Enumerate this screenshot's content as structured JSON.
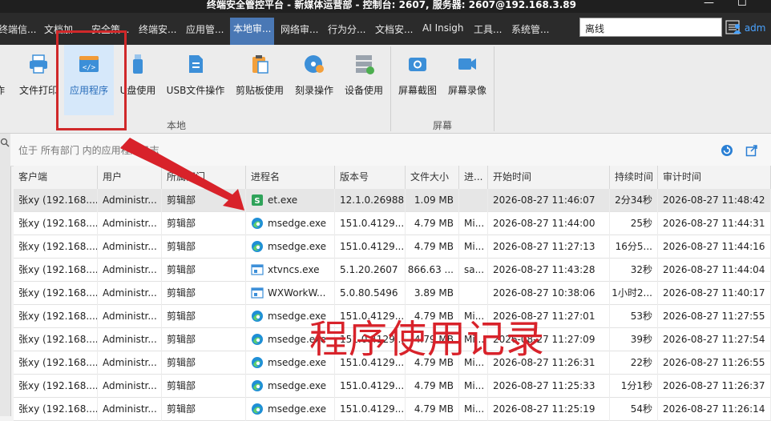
{
  "window": {
    "title": "终端安全管控平台 - 新媒体运营部 - 控制台: 2607, 服务器: 2607@192.168.3.89",
    "minimize": "—",
    "maximize": "☐"
  },
  "menubar": {
    "items": [
      {
        "label": "终端信..."
      },
      {
        "label": "文档加..."
      },
      {
        "label": "安全策..."
      },
      {
        "label": "终端安..."
      },
      {
        "label": "应用管..."
      },
      {
        "label": "本地审..."
      },
      {
        "label": "网络审..."
      },
      {
        "label": "行为分..."
      },
      {
        "label": "文档安..."
      },
      {
        "label": "AI Insigh"
      },
      {
        "label": "工具..."
      },
      {
        "label": "系统管..."
      }
    ],
    "active_index": 5,
    "search_value": "离线",
    "user": "adm"
  },
  "ribbon": {
    "buttons": [
      {
        "label": "作",
        "icon": "print-icon"
      },
      {
        "label": "文件打印",
        "icon": "printer-icon"
      },
      {
        "label": "应用程序",
        "icon": "app-code-icon"
      },
      {
        "label": "U盘使用",
        "icon": "usb-drive-icon"
      },
      {
        "label": "USB文件操作",
        "icon": "usb-file-icon"
      },
      {
        "label": "剪贴板使用",
        "icon": "clipboard-icon"
      },
      {
        "label": "刻录操作",
        "icon": "disc-burn-icon"
      },
      {
        "label": "设备使用",
        "icon": "device-icon"
      },
      {
        "label": "屏幕截图",
        "icon": "screenshot-icon"
      },
      {
        "label": "屏幕录像",
        "icon": "screen-record-icon"
      }
    ],
    "groups": [
      {
        "label": "本地"
      },
      {
        "label": "屏幕"
      }
    ]
  },
  "pathbar": {
    "text": "位于 所有部门 内的应用程序日志"
  },
  "table": {
    "columns": [
      "客户端",
      "用户",
      "所属部门",
      "进程名",
      "版本号",
      "文件大小",
      "进...",
      "开始时间",
      "持续时间",
      "审计时间"
    ],
    "rows": [
      {
        "client": "张xy (192.168....",
        "user": "Administr...",
        "dept": "剪辑部",
        "proc": "et.exe",
        "icon": "wps-icon",
        "ver": "12.1.0.26988",
        "size": "1.09 MB",
        "pub": "",
        "start": "2026-08-27 11:46:07",
        "dur": "2分34秒",
        "audit": "2026-08-27 11:48:42"
      },
      {
        "client": "张xy (192.168....",
        "user": "Administr...",
        "dept": "剪辑部",
        "proc": "msedge.exe",
        "icon": "edge-icon",
        "ver": "151.0.4129....",
        "size": "4.79 MB",
        "pub": "Mi...",
        "start": "2026-08-27 11:44:00",
        "dur": "25秒",
        "audit": "2026-08-27 11:44:31"
      },
      {
        "client": "张xy (192.168....",
        "user": "Administr...",
        "dept": "剪辑部",
        "proc": "msedge.exe",
        "icon": "edge-icon",
        "ver": "151.0.4129....",
        "size": "4.79 MB",
        "pub": "Mi...",
        "start": "2026-08-27 11:27:13",
        "dur": "16分5...",
        "audit": "2026-08-27 11:44:16"
      },
      {
        "client": "张xy (192.168....",
        "user": "Administr...",
        "dept": "剪辑部",
        "proc": "xtvncs.exe",
        "icon": "window-icon",
        "ver": "5.1.20.2607",
        "size": "866.63 ...",
        "pub": "sa...",
        "start": "2026-08-27 11:43:28",
        "dur": "32秒",
        "audit": "2026-08-27 11:44:04"
      },
      {
        "client": "张xy (192.168....",
        "user": "Administr...",
        "dept": "剪辑部",
        "proc": "WXWorkW...",
        "icon": "window-icon",
        "ver": "5.0.80.5496",
        "size": "3.89 MB",
        "pub": "",
        "start": "2026-08-27 10:38:06",
        "dur": "1小时2...",
        "audit": "2026-08-27 11:40:17"
      },
      {
        "client": "张xy (192.168....",
        "user": "Administr...",
        "dept": "剪辑部",
        "proc": "msedge.exe",
        "icon": "edge-icon",
        "ver": "151.0.4129....",
        "size": "4.79 MB",
        "pub": "Mi...",
        "start": "2026-08-27 11:27:01",
        "dur": "53秒",
        "audit": "2026-08-27 11:27:55"
      },
      {
        "client": "张xy (192.168....",
        "user": "Administr...",
        "dept": "剪辑部",
        "proc": "msedge.exe",
        "icon": "edge-icon",
        "ver": "151.0.4129....",
        "size": "4.79 MB",
        "pub": "Mi...",
        "start": "2026-08-27 11:27:09",
        "dur": "39秒",
        "audit": "2026-08-27 11:27:54"
      },
      {
        "client": "张xy (192.168....",
        "user": "Administr...",
        "dept": "剪辑部",
        "proc": "msedge.exe",
        "icon": "edge-icon",
        "ver": "151.0.4129....",
        "size": "4.79 MB",
        "pub": "Mi...",
        "start": "2026-08-27 11:26:31",
        "dur": "22秒",
        "audit": "2026-08-27 11:26:55"
      },
      {
        "client": "张xy (192.168....",
        "user": "Administr...",
        "dept": "剪辑部",
        "proc": "msedge.exe",
        "icon": "edge-icon",
        "ver": "151.0.4129....",
        "size": "4.79 MB",
        "pub": "Mi...",
        "start": "2026-08-27 11:25:33",
        "dur": "1分1秒",
        "audit": "2026-08-27 11:26:37"
      },
      {
        "client": "张xy (192.168....",
        "user": "Administr...",
        "dept": "剪辑部",
        "proc": "msedge.exe",
        "icon": "edge-icon",
        "ver": "151.0.4129....",
        "size": "4.79 MB",
        "pub": "Mi...",
        "start": "2026-08-27 11:25:19",
        "dur": "54秒",
        "audit": "2026-08-27 11:26:14"
      }
    ]
  },
  "annotation": {
    "text": "程序使用记录",
    "color": "#d8222a"
  }
}
